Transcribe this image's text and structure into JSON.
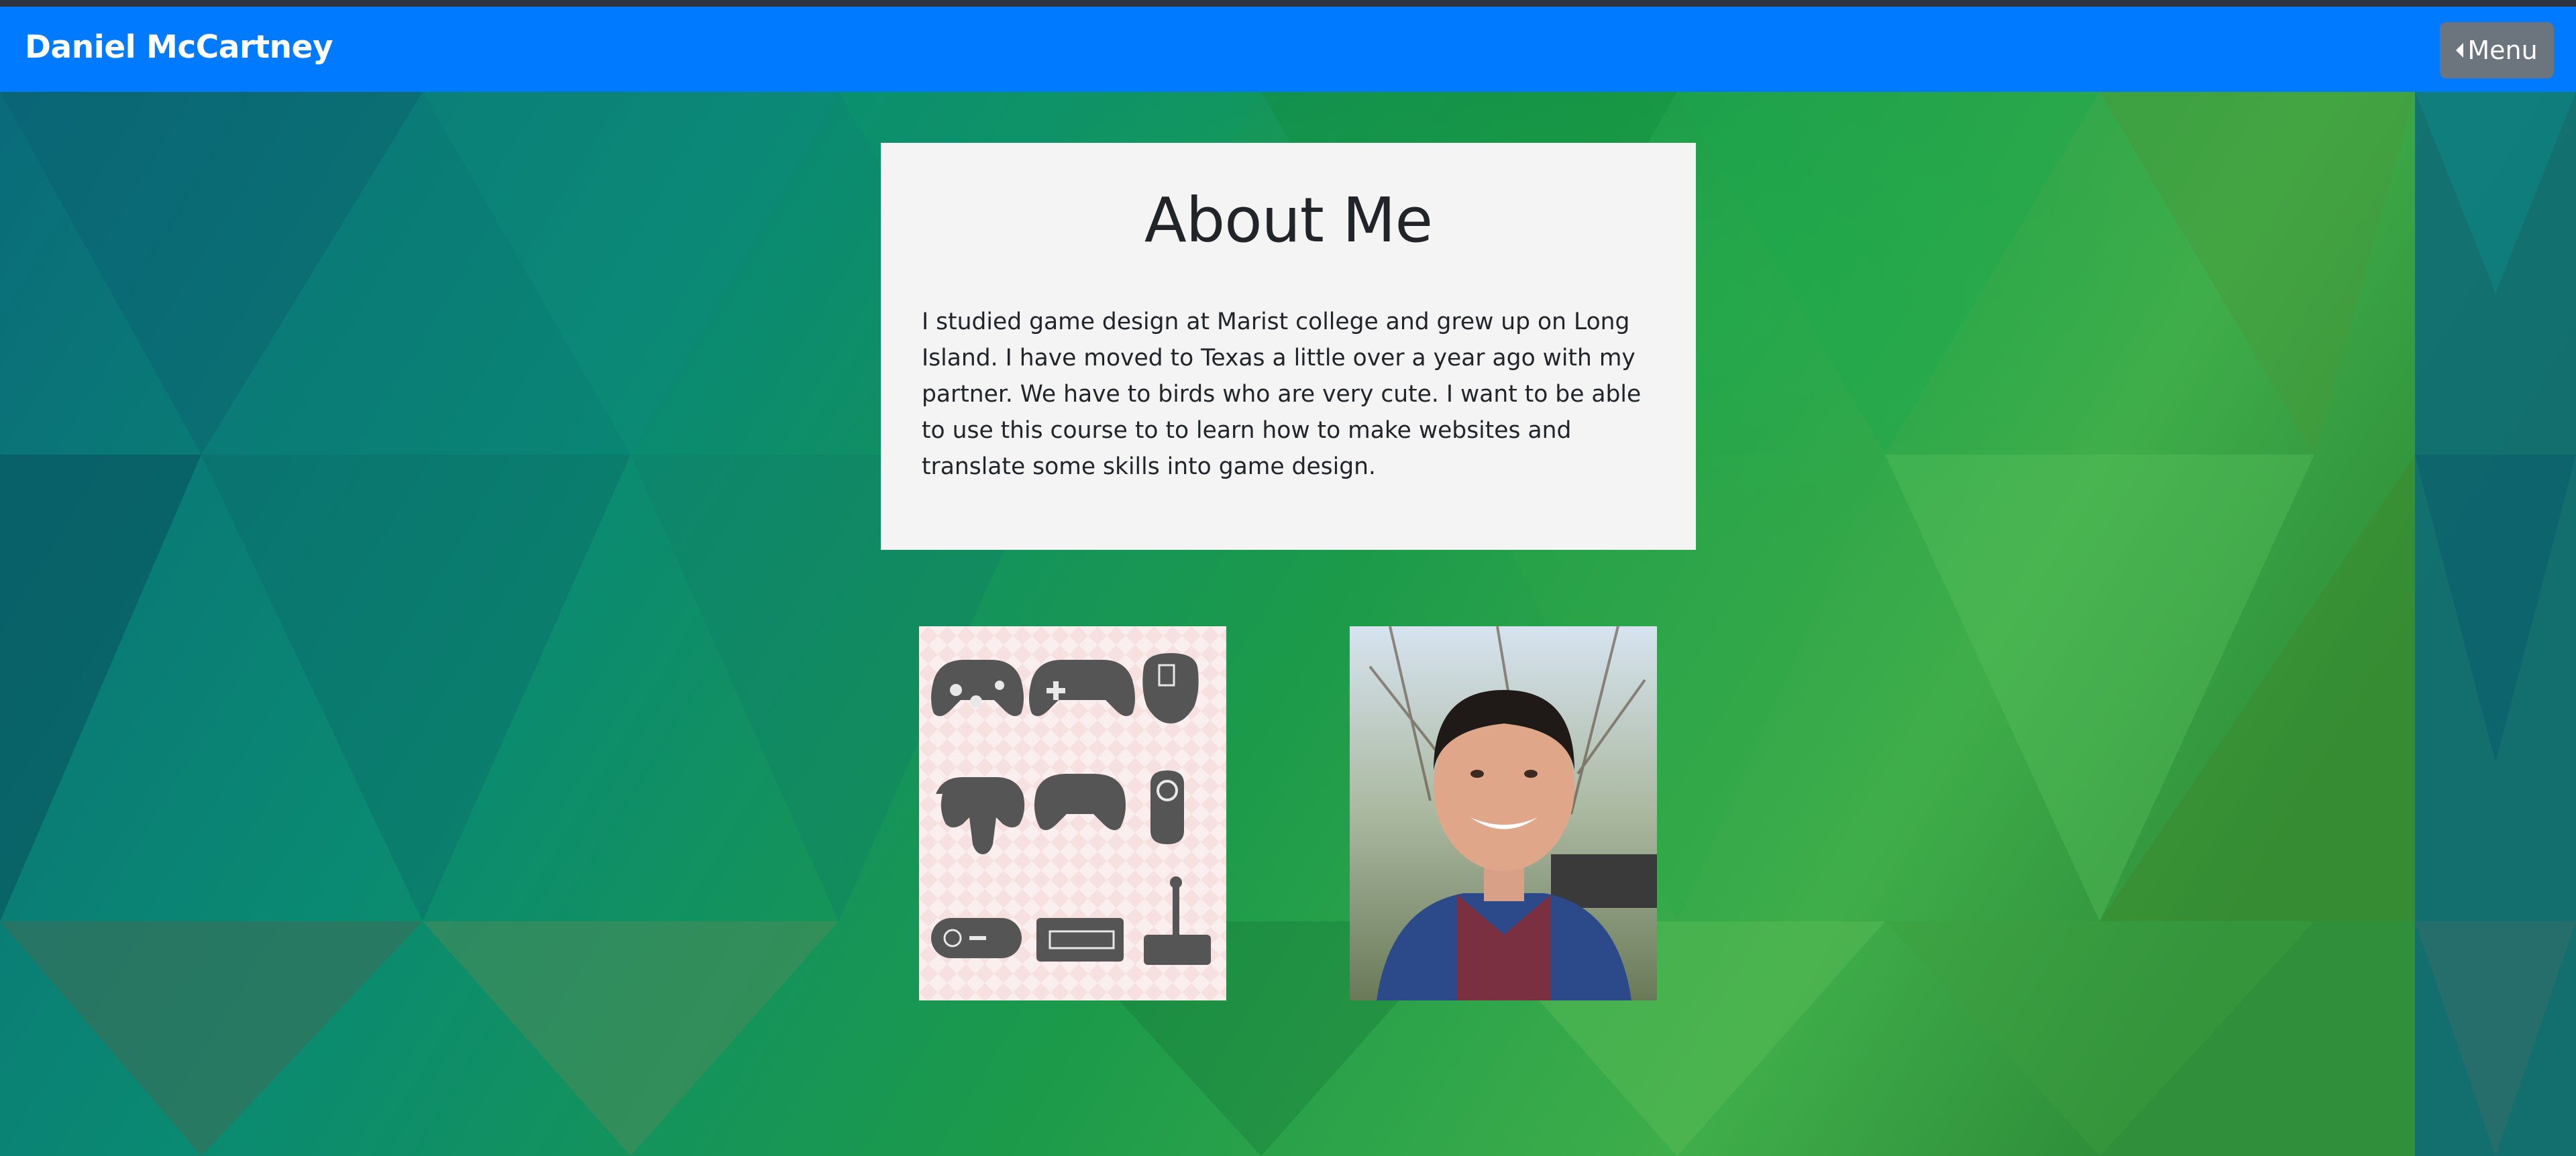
{
  "navbar": {
    "brand": "Daniel McCartney",
    "menu_label": "Menu",
    "menu_icon": "caret-left-icon",
    "color": "#007bff"
  },
  "about": {
    "title": "About Me",
    "body": "I studied game design at Marist college and grew up on Long Island. I have moved to Texas a little over a year ago with my partner. We have to birds who are very cute. I want to be able to use this course to to learn how to make websites and translate some skills into game design."
  },
  "images": [
    {
      "name": "game-controllers-collage"
    },
    {
      "name": "portrait-photo"
    }
  ],
  "colors": {
    "card_background": "#f4f4f4",
    "menu_button": "#6c757d",
    "text": "#212529"
  }
}
